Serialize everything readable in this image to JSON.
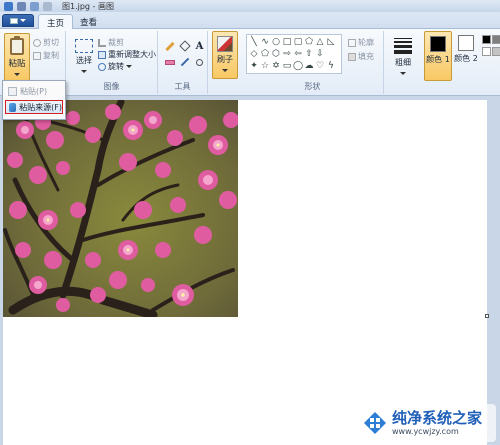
{
  "window": {
    "title": "图1.jpg - 画图"
  },
  "tabs": [
    {
      "label": "主页"
    },
    {
      "label": "查看"
    }
  ],
  "clipboard": {
    "paste_label": "粘贴",
    "cut_label": "剪切",
    "copy_label": "复制"
  },
  "image": {
    "select_label": "选择",
    "crop_label": "裁剪",
    "resize_label": "重新调整大小",
    "rotate_label": "旋转",
    "group_label": "图像"
  },
  "tools": {
    "group_label": "工具",
    "text_tool_glyph": "A"
  },
  "brushes": {
    "label": "刷子"
  },
  "shapes": {
    "outline_label": "轮廓",
    "fill_label": "填充",
    "group_label": "形状"
  },
  "size": {
    "label": "粗细"
  },
  "colors": {
    "color1_label": "颜色 1",
    "color2_label": "颜色 2",
    "color1_value": "#000000",
    "color2_value": "#ffffff",
    "palette_visible": [
      "#000000",
      "#ffffff",
      "#7f7f7f",
      "#c3c3c3"
    ]
  },
  "paste_menu": {
    "items": [
      {
        "label": "粘贴(P)",
        "enabled": false
      },
      {
        "label": "粘贴来源(F)",
        "enabled": true,
        "highlighted": true
      }
    ]
  },
  "watermark": {
    "title": "纯净系统之家",
    "url": "www.ycwjzy.com"
  }
}
